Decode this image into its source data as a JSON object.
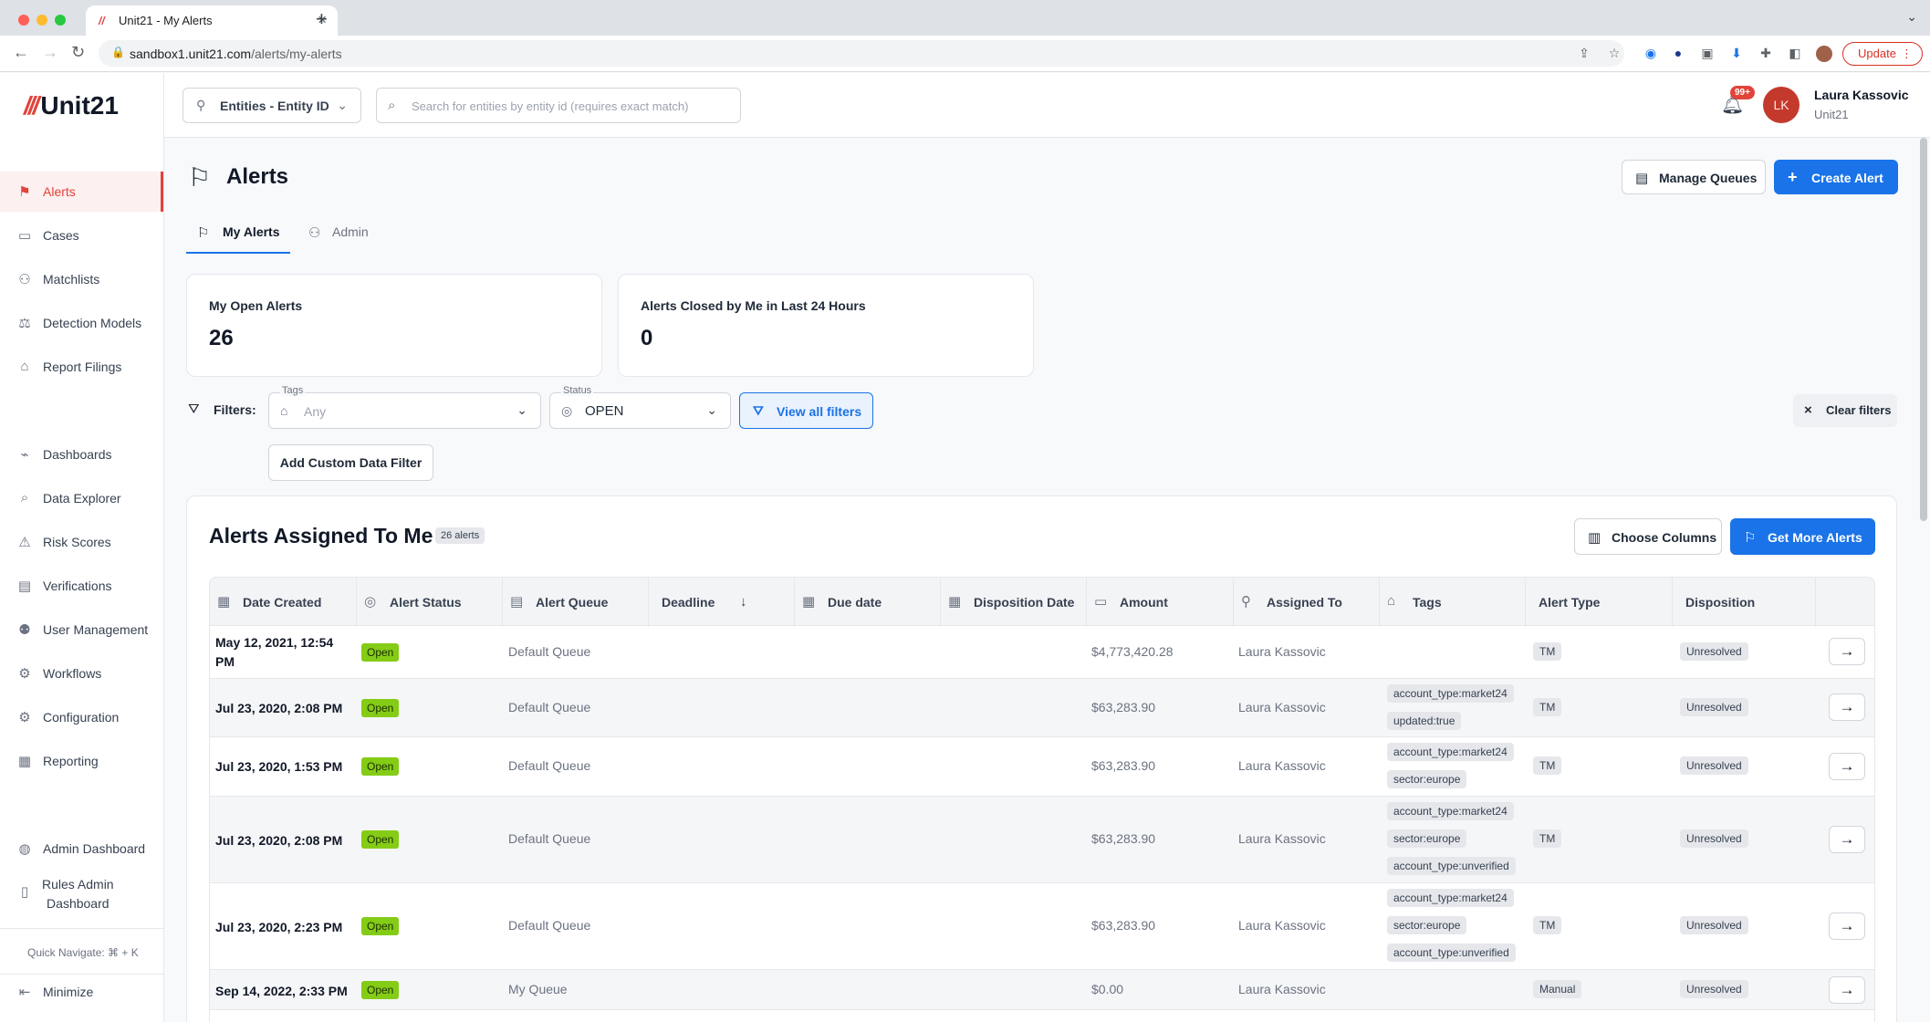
{
  "browser": {
    "tab_title": "Unit21 - My Alerts",
    "url_host": "sandbox1.unit21.com",
    "url_path": "/alerts/my-alerts",
    "update_label": "Update"
  },
  "app": {
    "logo_text": "Unit21",
    "entity_selector": "Entities - Entity ID",
    "search_placeholder": "Search for entities by entity id (requires exact match)",
    "notification_count": "99+",
    "user_initials": "LK",
    "user_name": "Laura Kassovic",
    "user_org": "Unit21"
  },
  "sidebar": {
    "items": [
      {
        "label": "Alerts",
        "icon": "flag-icon"
      },
      {
        "label": "Cases",
        "icon": "briefcase-icon"
      },
      {
        "label": "Matchlists",
        "icon": "person-add-icon"
      },
      {
        "label": "Detection Models",
        "icon": "scale-icon"
      },
      {
        "label": "Report Filings",
        "icon": "bank-icon"
      },
      {
        "label": "Dashboards",
        "icon": "chart-icon"
      },
      {
        "label": "Data Explorer",
        "icon": "search-data-icon"
      },
      {
        "label": "Risk Scores",
        "icon": "warning-icon"
      },
      {
        "label": "Verifications",
        "icon": "id-card-icon"
      },
      {
        "label": "User Management",
        "icon": "users-icon"
      },
      {
        "label": "Workflows",
        "icon": "workflow-icon"
      },
      {
        "label": "Configuration",
        "icon": "gear-icon"
      },
      {
        "label": "Reporting",
        "icon": "report-icon"
      },
      {
        "label": "Admin Dashboard",
        "icon": "globe-icon"
      },
      {
        "label": "Rules Admin",
        "label2": "Dashboard",
        "icon": "clipboard-icon"
      }
    ],
    "quick_navigate": "Quick Navigate: ⌘ + K",
    "minimize": "Minimize"
  },
  "page": {
    "title": "Alerts",
    "manage_queues": "Manage Queues",
    "create_alert": "Create Alert",
    "tabs": [
      "My Alerts",
      "Admin"
    ],
    "cards": [
      {
        "title": "My Open Alerts",
        "value": "26"
      },
      {
        "title": "Alerts Closed by Me in Last 24 Hours",
        "value": "0"
      }
    ],
    "filters_label": "Filters:",
    "tags_legend": "Tags",
    "tags_value": "Any",
    "status_legend": "Status",
    "status_value": "OPEN",
    "view_all_filters": "View all filters",
    "clear_filters": "Clear filters",
    "add_custom_filter": "Add Custom Data Filter"
  },
  "table": {
    "title": "Alerts Assigned To Me",
    "count": "26 alerts",
    "choose_columns": "Choose Columns",
    "get_more_alerts": "Get More Alerts",
    "columns": [
      "Date Created",
      "Alert Status",
      "Alert Queue",
      "Deadline",
      "Due date",
      "Disposition Date",
      "Amount",
      "Assigned To",
      "Tags",
      "Alert Type",
      "Disposition"
    ],
    "rows": [
      {
        "date": "May 12, 2021, 12:54 PM",
        "status": "Open",
        "queue": "Default Queue",
        "amount": "$4,773,420.28",
        "assigned": "Laura Kassovic",
        "tags": [],
        "type": "TM",
        "disposition": "Unresolved"
      },
      {
        "date": "Jul 23, 2020, 2:08 PM",
        "status": "Open",
        "queue": "Default Queue",
        "amount": "$63,283.90",
        "assigned": "Laura Kassovic",
        "tags": [
          "account_type:market24",
          "updated:true"
        ],
        "type": "TM",
        "disposition": "Unresolved"
      },
      {
        "date": "Jul 23, 2020, 1:53 PM",
        "status": "Open",
        "queue": "Default Queue",
        "amount": "$63,283.90",
        "assigned": "Laura Kassovic",
        "tags": [
          "account_type:market24",
          "sector:europe"
        ],
        "type": "TM",
        "disposition": "Unresolved"
      },
      {
        "date": "Jul 23, 2020, 2:08 PM",
        "status": "Open",
        "queue": "Default Queue",
        "amount": "$63,283.90",
        "assigned": "Laura Kassovic",
        "tags": [
          "account_type:market24",
          "sector:europe",
          "account_type:unverified"
        ],
        "type": "TM",
        "disposition": "Unresolved"
      },
      {
        "date": "Jul 23, 2020, 2:23 PM",
        "status": "Open",
        "queue": "Default Queue",
        "amount": "$63,283.90",
        "assigned": "Laura Kassovic",
        "tags": [
          "account_type:market24",
          "sector:europe",
          "account_type:unverified"
        ],
        "type": "TM",
        "disposition": "Unresolved"
      },
      {
        "date": "Sep 14, 2022, 2:33 PM",
        "status": "Open",
        "queue": "My Queue",
        "amount": "$0.00",
        "assigned": "Laura Kassovic",
        "tags": [],
        "type": "Manual",
        "disposition": "Unresolved"
      }
    ]
  },
  "colors": {
    "brand": "#e0443a",
    "primary": "#1a73e8",
    "open_pill": "#84cc16"
  }
}
